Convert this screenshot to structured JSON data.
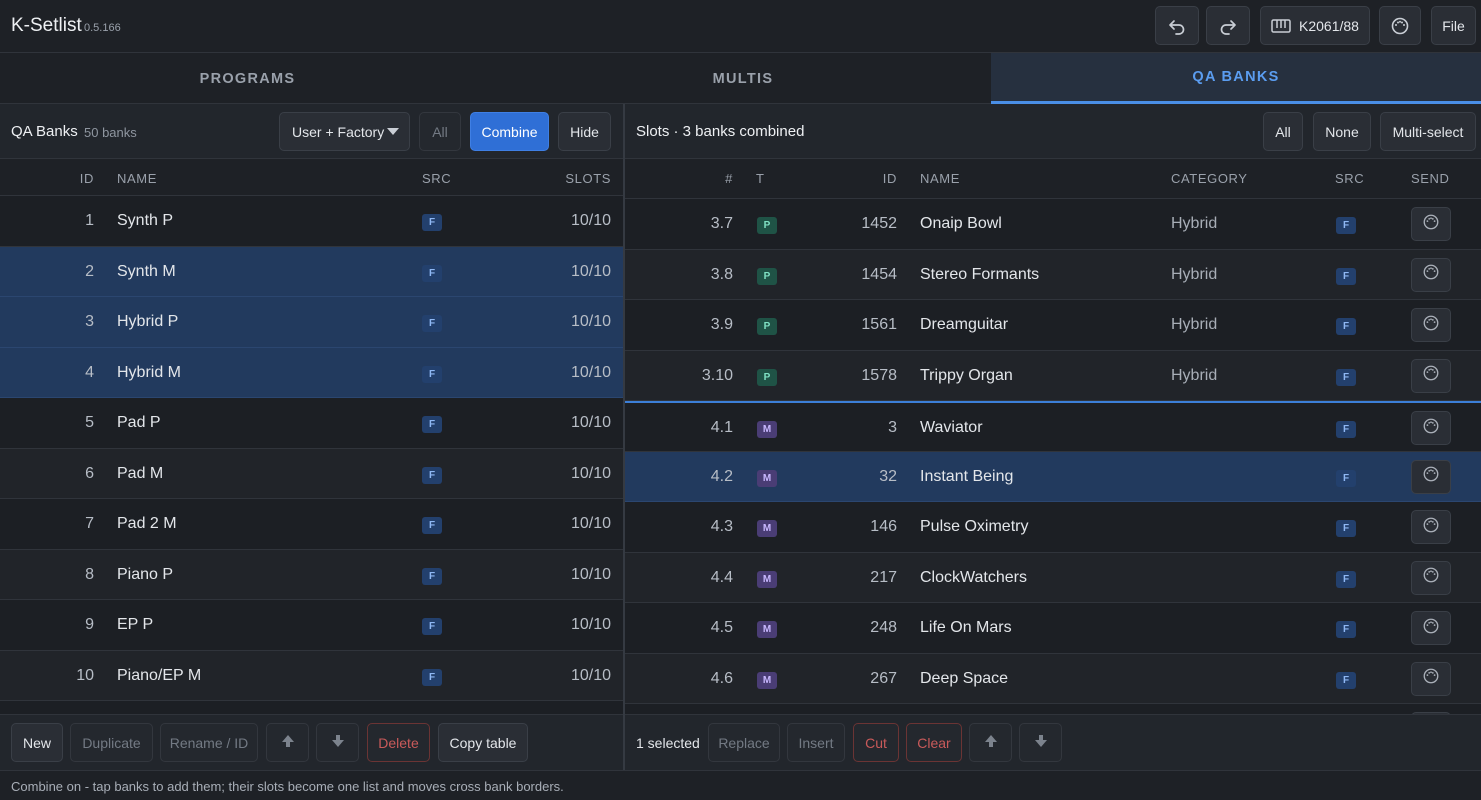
{
  "app": {
    "title": "K-Setlist",
    "version": "0.5.166"
  },
  "header": {
    "device_label": "K2061/88",
    "file_label": "File",
    "icons": [
      "undo-icon",
      "redo-icon",
      "keyboard-icon",
      "midi-icon"
    ]
  },
  "tabs": [
    {
      "label": "PROGRAMS",
      "active": false
    },
    {
      "label": "MULTIS",
      "active": false
    },
    {
      "label": "QA BANKS",
      "active": true
    }
  ],
  "left_panel": {
    "title": "QA Banks",
    "count": "50 banks",
    "filter_select": "User + Factory",
    "all_label": "All",
    "combine_label": "Combine",
    "hide_label": "Hide",
    "columns": {
      "id": "ID",
      "name": "NAME",
      "src": "SRC",
      "slots": "SLOTS"
    },
    "rows": [
      {
        "id": "1",
        "name": "Synth P",
        "src": "F",
        "slots": "10/10",
        "selected": false
      },
      {
        "id": "2",
        "name": "Synth M",
        "src": "F",
        "slots": "10/10",
        "selected": true
      },
      {
        "id": "3",
        "name": "Hybrid P",
        "src": "F",
        "slots": "10/10",
        "selected": true
      },
      {
        "id": "4",
        "name": "Hybrid M",
        "src": "F",
        "slots": "10/10",
        "selected": true
      },
      {
        "id": "5",
        "name": "Pad P",
        "src": "F",
        "slots": "10/10",
        "selected": false
      },
      {
        "id": "6",
        "name": "Pad M",
        "src": "F",
        "slots": "10/10",
        "selected": false
      },
      {
        "id": "7",
        "name": "Pad 2 M",
        "src": "F",
        "slots": "10/10",
        "selected": false
      },
      {
        "id": "8",
        "name": "Piano P",
        "src": "F",
        "slots": "10/10",
        "selected": false
      },
      {
        "id": "9",
        "name": "EP P",
        "src": "F",
        "slots": "10/10",
        "selected": false
      },
      {
        "id": "10",
        "name": "Piano/EP M",
        "src": "F",
        "slots": "10/10",
        "selected": false
      }
    ],
    "footer": {
      "new_label": "New",
      "duplicate_label": "Duplicate",
      "rename_label": "Rename / ID",
      "delete_label": "Delete",
      "copy_label": "Copy table"
    }
  },
  "right_panel": {
    "title": "Slots · 3 banks combined",
    "all_label": "All",
    "none_label": "None",
    "multiselect_label": "Multi-select",
    "columns": {
      "num": "#",
      "type": "T",
      "id": "ID",
      "name": "NAME",
      "category": "CATEGORY",
      "src": "SRC",
      "send": "SEND"
    },
    "rows": [
      {
        "num": "3.7",
        "type": "P",
        "id": "1452",
        "name": "Onaip Bowl",
        "category": "Hybrid",
        "src": "F",
        "selected": false
      },
      {
        "num": "3.8",
        "type": "P",
        "id": "1454",
        "name": "Stereo Formants",
        "category": "Hybrid",
        "src": "F",
        "selected": false
      },
      {
        "num": "3.9",
        "type": "P",
        "id": "1561",
        "name": "Dreamguitar",
        "category": "Hybrid",
        "src": "F",
        "selected": false
      },
      {
        "num": "3.10",
        "type": "P",
        "id": "1578",
        "name": "Trippy Organ",
        "category": "Hybrid",
        "src": "F",
        "selected": false
      },
      {
        "num": "4.1",
        "type": "M",
        "id": "3",
        "name": "Waviator",
        "category": "",
        "src": "F",
        "selected": false
      },
      {
        "num": "4.2",
        "type": "M",
        "id": "32",
        "name": "Instant Being",
        "category": "",
        "src": "F",
        "selected": true
      },
      {
        "num": "4.3",
        "type": "M",
        "id": "146",
        "name": "Pulse Oximetry",
        "category": "",
        "src": "F",
        "selected": false
      },
      {
        "num": "4.4",
        "type": "M",
        "id": "217",
        "name": "ClockWatchers",
        "category": "",
        "src": "F",
        "selected": false
      },
      {
        "num": "4.5",
        "type": "M",
        "id": "248",
        "name": "Life On Mars",
        "category": "",
        "src": "F",
        "selected": false
      },
      {
        "num": "4.6",
        "type": "M",
        "id": "267",
        "name": "Deep Space",
        "category": "",
        "src": "F",
        "selected": false
      },
      {
        "num": "",
        "type": "",
        "id": "",
        "name": "",
        "category": "",
        "src": "",
        "selected": false
      }
    ],
    "footer": {
      "selected_text": "1 selected",
      "replace_label": "Replace",
      "insert_label": "Insert",
      "cut_label": "Cut",
      "clear_label": "Clear"
    }
  },
  "status": "Combine on - tap banks to add them; their slots become one list and moves cross bank borders."
}
